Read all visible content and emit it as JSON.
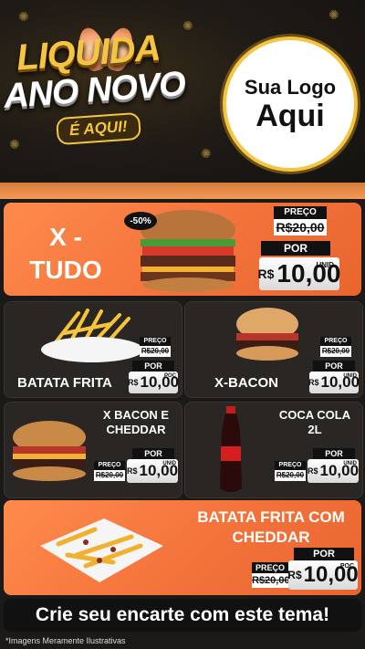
{
  "header": {
    "promo_line1": "LIQUIDA",
    "promo_line2": "ANO NOVO",
    "promo_tag": "É AQUI!",
    "logo_line1": "Sua Logo",
    "logo_line2": "Aqui"
  },
  "products": {
    "xtudo": {
      "name": "X - TUDO",
      "discount": "-50%",
      "preco_label": "PREÇO",
      "old_price": "R$20,00",
      "por_label": "POR",
      "currency": "R$",
      "price": "10,00",
      "unit": "UNID"
    },
    "batata": {
      "name": "BATATA FRITA",
      "preco_label": "PREÇO",
      "old_price": "R$20,00",
      "por_label": "POR",
      "currency": "R$",
      "price": "10,00",
      "unit": "POÇ"
    },
    "xbacon": {
      "name": "X-BACON",
      "preco_label": "PREÇO",
      "old_price": "R$20,00",
      "por_label": "POR",
      "currency": "R$",
      "price": "10,00",
      "unit": "UNID"
    },
    "xbaconcheddar": {
      "name": "X BACON E CHEDDAR",
      "preco_label": "PREÇO",
      "old_price": "R$20,00",
      "por_label": "POR",
      "currency": "R$",
      "price": "10,00",
      "unit": "UNID"
    },
    "coca": {
      "name": "COCA COLA 2L",
      "preco_label": "PREÇO",
      "old_price": "R$20,00",
      "por_label": "POR",
      "currency": "R$",
      "price": "10,00",
      "unit": "UNID"
    },
    "batatacheddar": {
      "name": "BATATA FRITA COM CHEDDAR",
      "preco_label": "PREÇO",
      "old_price": "R$20,00",
      "por_label": "POR",
      "currency": "R$",
      "price": "10,00",
      "unit": "POÇ"
    }
  },
  "footer": {
    "cta": "Crie seu encarte com este tema!",
    "note": "*Imagens Meramente Ilustrativas"
  },
  "colors": {
    "orange": "#f2713a",
    "gold": "#f4c542",
    "dark": "#2a2623"
  }
}
